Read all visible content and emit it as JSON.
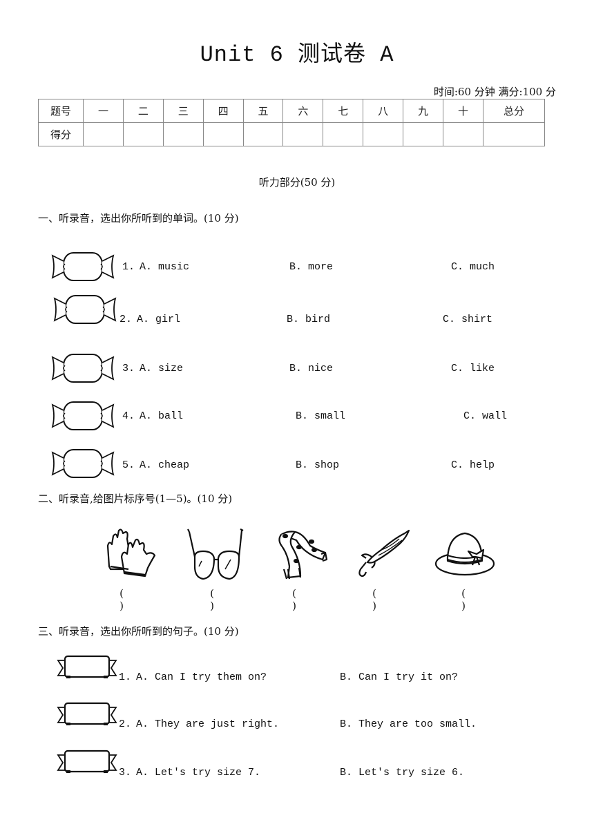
{
  "document": {
    "title": "Unit 6 测试卷 A",
    "meta": "时间:60 分钟  满分:100 分"
  },
  "score_table": {
    "header_row": [
      "题号",
      "一",
      "二",
      "三",
      "四",
      "五",
      "六",
      "七",
      "八",
      "九",
      "十",
      "总分"
    ],
    "score_row_label": "得分"
  },
  "listening_section": {
    "title": "听力部分(50 分)"
  },
  "part1": {
    "heading": "一、听录音，选出你所听到的单词。(10 分)",
    "items": [
      {
        "num": "1.",
        "a": "A.  music",
        "b": "B.  more",
        "c": "C.  much"
      },
      {
        "num": "2.",
        "a": "A.  girl",
        "b": "B.  bird",
        "c": "C.  shirt"
      },
      {
        "num": "3.",
        "a": "A.  size",
        "b": "B.  nice",
        "c": "C.  like"
      },
      {
        "num": "4.",
        "a": "A.  ball",
        "b": "B.  small",
        "c": "C.  wall"
      },
      {
        "num": "5.",
        "a": "A.  cheap",
        "b": "B.  shop",
        "c": "C.  help"
      }
    ]
  },
  "part2": {
    "heading": "二、听录音,给图片标序号(1—5)。(10 分)",
    "pictures": [
      {
        "icon": "gloves-icon",
        "blank": "(  )"
      },
      {
        "icon": "glasses-icon",
        "blank": "(  )"
      },
      {
        "icon": "scarf-icon",
        "blank": "(  )"
      },
      {
        "icon": "umbrella-icon",
        "blank": "(  )"
      },
      {
        "icon": "hat-icon",
        "blank": "(  )"
      }
    ]
  },
  "part3": {
    "heading": "三、听录音，选出你所听到的句子。(10 分)",
    "items": [
      {
        "num": "1.",
        "a": "A.  Can I try them on?",
        "b": "B.  Can I try it on?"
      },
      {
        "num": "2.",
        "a": "A.  They are just right.",
        "b": "B.  They are too small."
      },
      {
        "num": "3.",
        "a": "A.  Let's try size 7.",
        "b": "B.  Let's try size 6."
      }
    ]
  }
}
